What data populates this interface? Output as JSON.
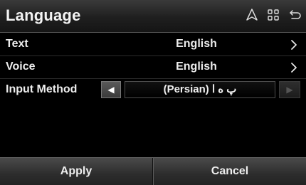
{
  "header": {
    "title": "Language",
    "icons": [
      "navigation-arrow-icon",
      "grid-menu-icon",
      "back-icon"
    ]
  },
  "settings": {
    "text": {
      "label": "Text",
      "value": "English"
    },
    "voice": {
      "label": "Voice",
      "value": "English"
    },
    "input_method": {
      "label": "Input Method",
      "value": "(Persian) پ ه ا"
    }
  },
  "footer": {
    "apply_label": "Apply",
    "cancel_label": "Cancel"
  }
}
